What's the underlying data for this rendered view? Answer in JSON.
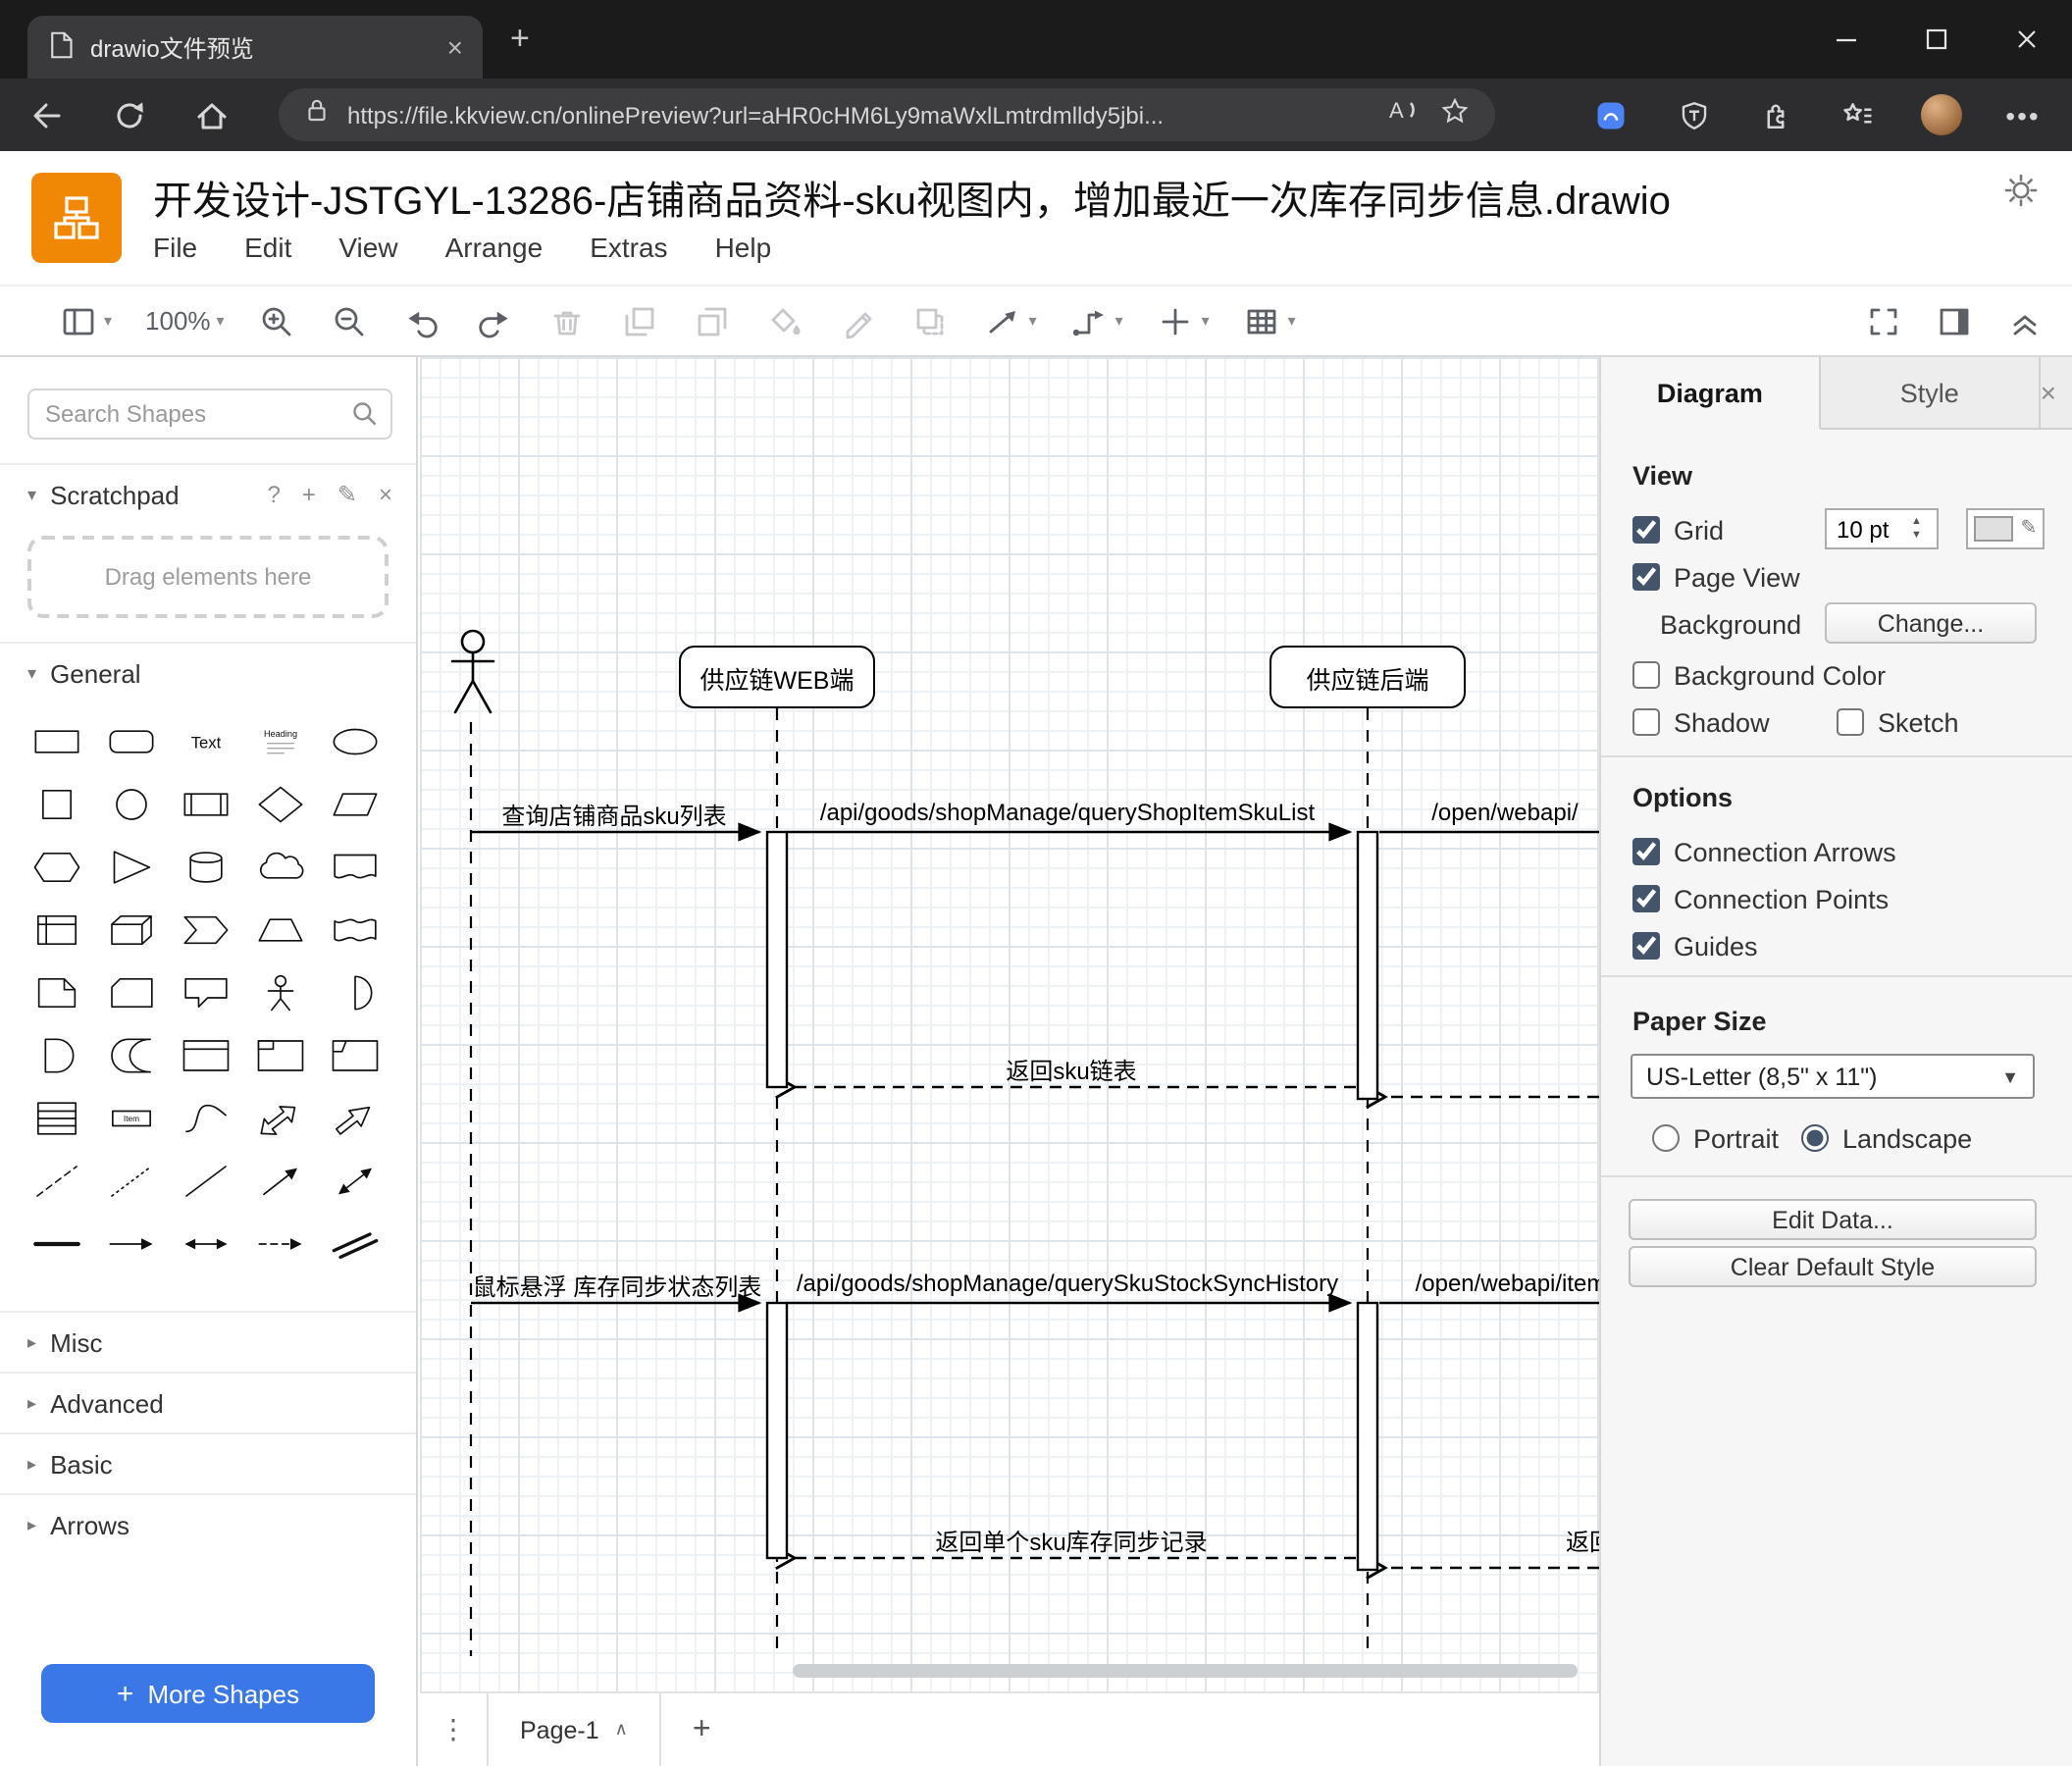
{
  "browser": {
    "tab_title": "drawio文件预览",
    "url": "https://file.kkview.cn/onlinePreview?url=aHR0cHM6Ly9maWxlLmtrdmlldy5jbi..."
  },
  "app": {
    "title": "开发设计-JSTGYL-13286-店铺商品资料-sku视图内，增加最近一次库存同步信息.drawio",
    "menus": [
      "File",
      "Edit",
      "View",
      "Arrange",
      "Extras",
      "Help"
    ],
    "zoom_level": "100%"
  },
  "sidebar": {
    "search_placeholder": "Search Shapes",
    "scratchpad_label": "Scratchpad",
    "scratchpad_hint": "Drag elements here",
    "sections": [
      "General",
      "Misc",
      "Advanced",
      "Basic",
      "Arrows"
    ],
    "more_shapes_label": "More Shapes",
    "palette": [
      "rectangle",
      "rounded-rectangle",
      "text",
      "textbox",
      "ellipse",
      "square",
      "circle",
      "process",
      "diamond",
      "parallelogram",
      "hexagon",
      "triangle",
      "cylinder",
      "cloud",
      "document",
      "internal-storage",
      "cube",
      "step",
      "trapezoid",
      "tape",
      "note",
      "card",
      "callout",
      "actor",
      "or",
      "and",
      "data-storage",
      "container",
      "container-title",
      "frame",
      "list",
      "list-item",
      "curve",
      "bidirectional-arrow",
      "arrow",
      "dashed-line",
      "dotted-line",
      "line",
      "diagonal-arrow",
      "diagonal-arrow-2",
      "horizontal-line",
      "horizontal-arrow",
      "horizontal-double-arrow",
      "dashed-arrow",
      "link"
    ]
  },
  "canvas": {
    "participants": [
      {
        "label": "供应链WEB端"
      },
      {
        "label": "供应链后端"
      }
    ],
    "messages": [
      {
        "label": "查询店铺商品sku列表"
      },
      {
        "label": "/api/goods/shopManage/queryShopItemSkuList"
      },
      {
        "label": "/open/webapi/"
      },
      {
        "label": "返回sku链表"
      },
      {
        "label": "鼠标悬浮 库存同步状态列表"
      },
      {
        "label": "/api/goods/shopManage/querySkuStockSyncHistory"
      },
      {
        "label": "/open/webapi/item"
      },
      {
        "label": "返回单个sku库存同步记录"
      },
      {
        "label": "返回"
      }
    ]
  },
  "pagebar": {
    "page_label": "Page-1"
  },
  "format": {
    "tab_diagram": "Diagram",
    "tab_style": "Style",
    "view_heading": "View",
    "grid_label": "Grid",
    "grid_size": "10 pt",
    "page_view_label": "Page View",
    "background_label": "Background",
    "change_button": "Change...",
    "background_color_label": "Background Color",
    "shadow_label": "Shadow",
    "sketch_label": "Sketch",
    "options_heading": "Options",
    "connection_arrows_label": "Connection Arrows",
    "connection_points_label": "Connection Points",
    "guides_label": "Guides",
    "paper_heading": "Paper Size",
    "paper_size_value": "US-Letter (8,5\" x 11\")",
    "portrait_label": "Portrait",
    "landscape_label": "Landscape",
    "edit_data_button": "Edit Data...",
    "clear_style_button": "Clear Default Style"
  },
  "colors": {
    "drawio_orange": "#f08705",
    "primary_blue": "#3b78e7"
  }
}
